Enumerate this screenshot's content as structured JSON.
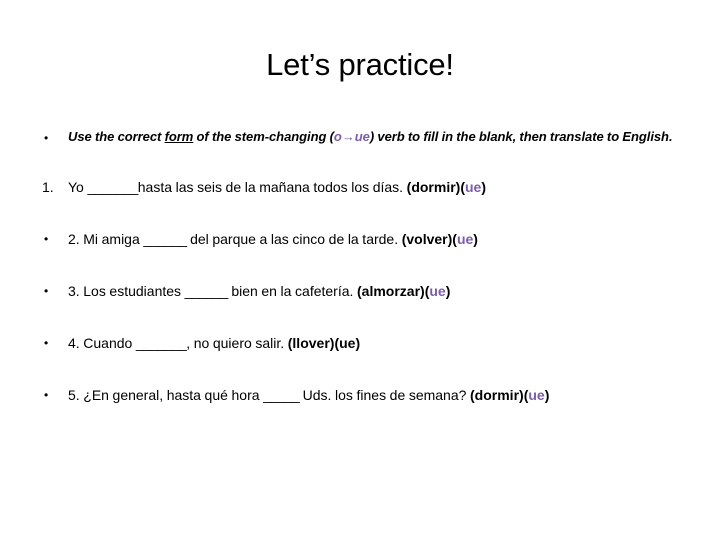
{
  "slide": {
    "title": "Let’s practice!",
    "colors": {
      "text": "#000000",
      "accent_purple": "#7B5EA7",
      "background": "#FFFFFF"
    },
    "instruction": {
      "marker": "•",
      "part1": "Use the correct ",
      "underlined": "form",
      "part2": " of the stem-changing (",
      "stem_change": "o→ue",
      "part3": ") verb to fill in the blank, then translate to English."
    },
    "items": [
      {
        "marker": "1.",
        "marker_type": "number",
        "text_before_blank": "Yo ",
        "blank": "_______",
        "text_after_blank": "hasta las seis de la mañana todos los días. ",
        "verb": "(dormir)",
        "hint_open": "(",
        "hint": "ue",
        "hint_close": ")",
        "hint_colored": true
      },
      {
        "marker": "•",
        "marker_type": "bullet",
        "text_before_blank": "2. Mi amiga ",
        "blank": "______",
        "text_after_blank": " del parque a las cinco de la tarde. ",
        "verb": "(volver)",
        "hint_open": "(",
        "hint": "ue",
        "hint_close": ")",
        "hint_colored": true
      },
      {
        "marker": "•",
        "marker_type": "bullet",
        "text_before_blank": "3. Los estudiantes ",
        "blank": "______",
        "text_after_blank": " bien en la cafetería. ",
        "verb": "(almorzar)",
        "hint_open": "(",
        "hint": "ue",
        "hint_close": ")",
        "hint_colored": true
      },
      {
        "marker": "•",
        "marker_type": "bullet",
        "text_before_blank": "4. Cuando ",
        "blank": "_______",
        "text_after_blank": ", no quiero salir. ",
        "verb": "(llover)",
        "hint_open": "(",
        "hint": "ue",
        "hint_close": ")",
        "hint_colored": false
      },
      {
        "marker": "•",
        "marker_type": "bullet",
        "text_before_blank": "5. ¿En general, hasta qué hora ",
        "blank": "_____",
        "text_after_blank": "  Uds. los fines de semana? ",
        "verb": "(dormir)",
        "hint_open": "(",
        "hint": "ue",
        "hint_close": ")",
        "hint_colored": true
      }
    ]
  }
}
